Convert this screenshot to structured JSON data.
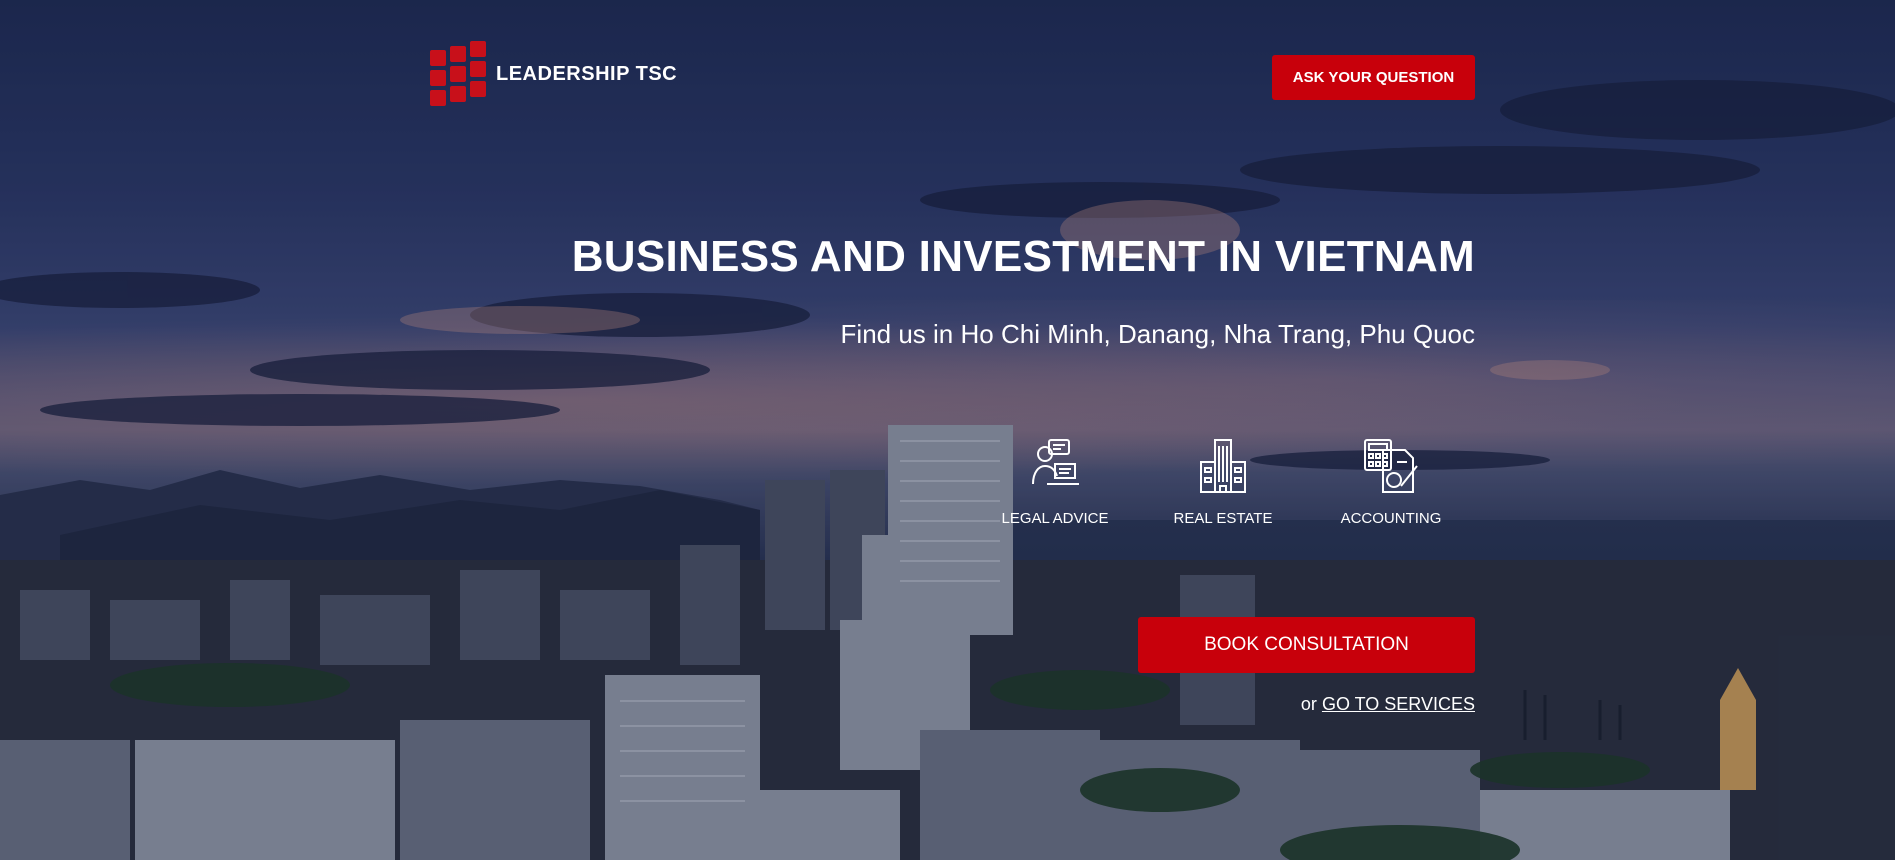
{
  "brand": {
    "name": "LEADERSHIP TSC",
    "accent": "#c8000b"
  },
  "header": {
    "ask_label": "ASK YOUR QUESTION"
  },
  "hero": {
    "title": "BUSINESS AND INVESTMENT IN VIETNAM",
    "subtitle": "Find us in Ho Chi Minh, Danang, Nha Trang, Phu Quoc"
  },
  "services": [
    {
      "label": "LEGAL ADVICE",
      "icon": "lawyer-icon"
    },
    {
      "label": "REAL ESTATE",
      "icon": "building-icon"
    },
    {
      "label": "ACCOUNTING",
      "icon": "calculator-icon"
    }
  ],
  "cta": {
    "book_label": "BOOK CONSULTATION",
    "or_text": "or",
    "services_link": "GO TO SERVICES"
  }
}
